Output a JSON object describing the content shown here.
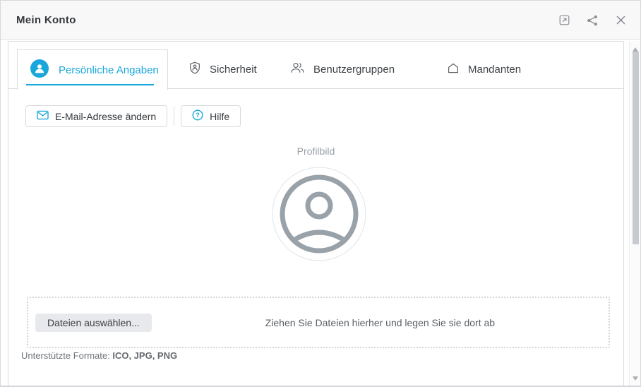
{
  "header": {
    "title": "Mein Konto"
  },
  "tabs": [
    {
      "label": "Persönliche Angaben",
      "icon": "person-circle",
      "active": true
    },
    {
      "label": "Sicherheit",
      "icon": "shield-person",
      "active": false
    },
    {
      "label": "Benutzergruppen",
      "icon": "people",
      "active": false
    },
    {
      "label": "Mandanten",
      "icon": "home",
      "active": false
    }
  ],
  "toolbar": {
    "change_email_label": "E-Mail-Adresse ändern",
    "help_label": "Hilfe"
  },
  "profile": {
    "photo_label": "Profilbild"
  },
  "upload": {
    "choose_files_label": "Dateien auswählen...",
    "drop_hint": "Ziehen Sie Dateien hierher und legen Sie sie dort ab",
    "supported_formats_label": "Unterstützte Formate:",
    "supported_formats": "ICO, JPG, PNG"
  },
  "icons": {
    "help_glyph": "?",
    "titlebar": [
      "open-in-new",
      "share",
      "close"
    ]
  },
  "colors": {
    "accent": "#18a7da",
    "icon_gray": "#5f6368",
    "text_dark": "#33373b",
    "muted_text": "#989ea5",
    "border": "#d9dce1",
    "header_bg": "#f8f8f9",
    "avatar_gray": "#99a1a9"
  }
}
